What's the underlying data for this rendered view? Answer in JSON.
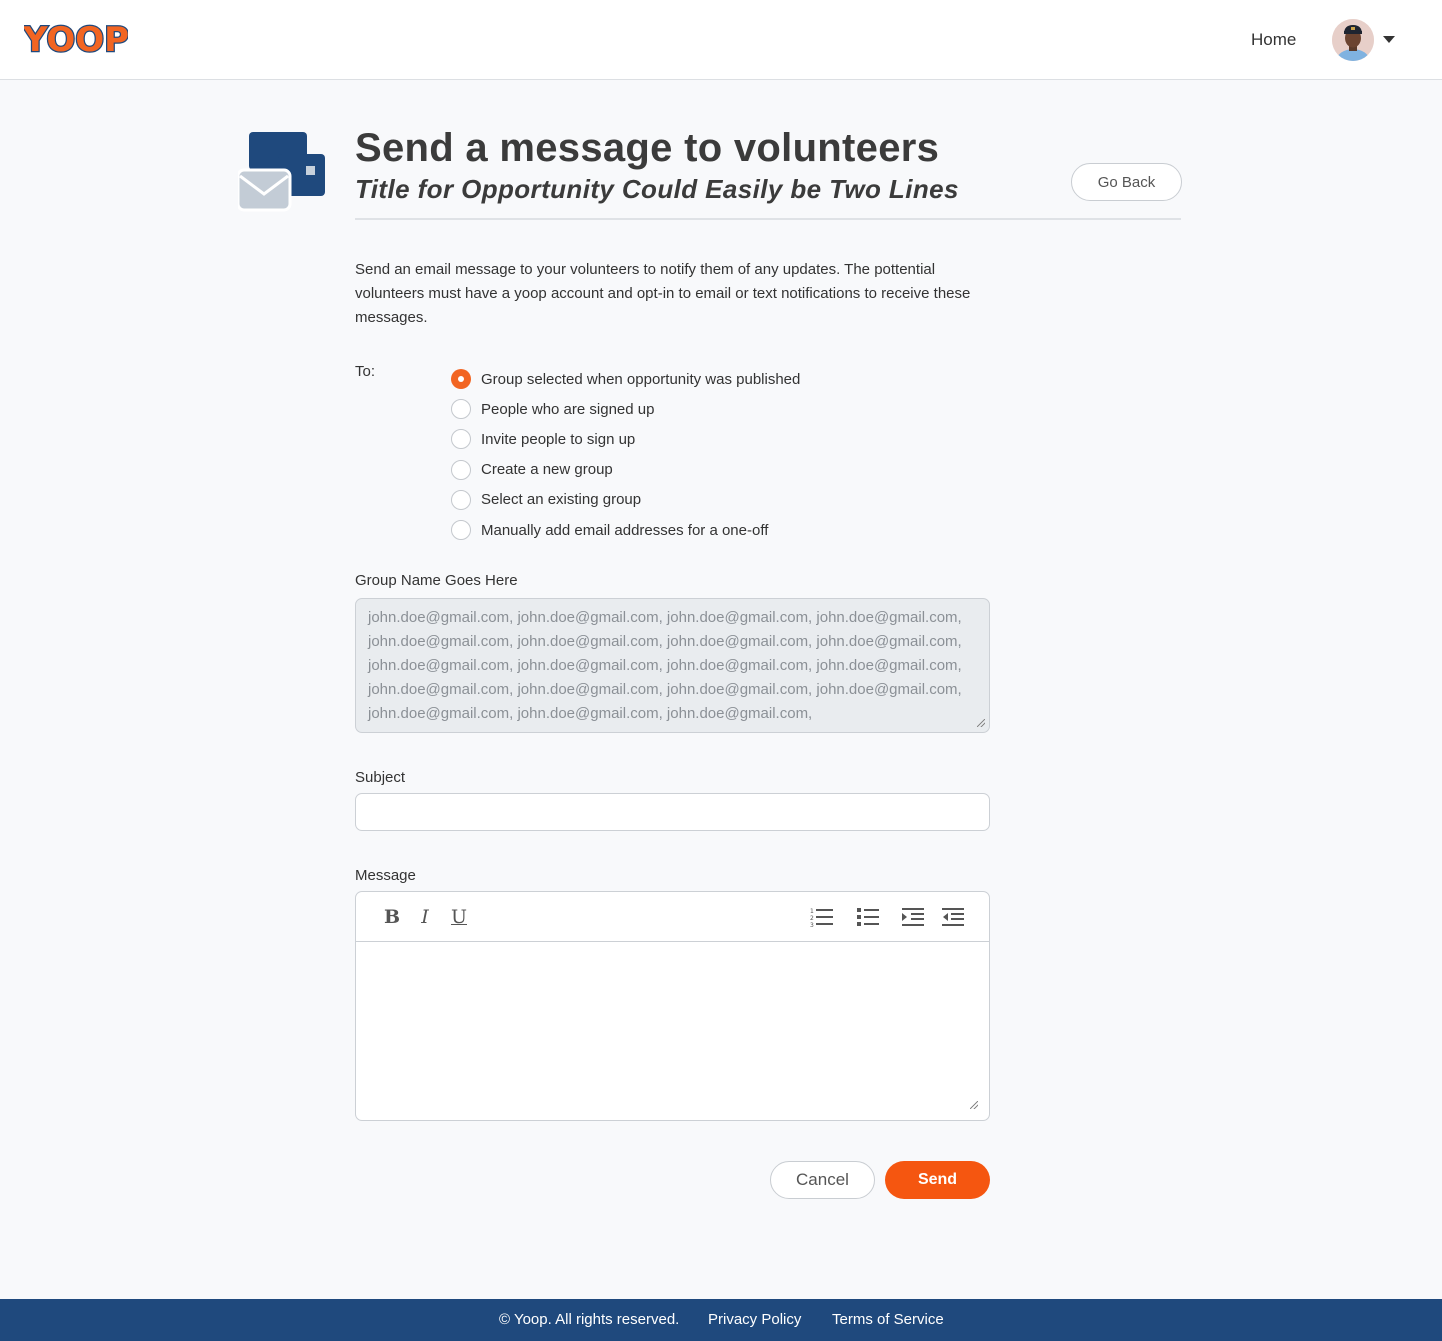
{
  "header": {
    "logo_text": "YOOP",
    "nav_home": "Home",
    "avatar_alt": "User avatar"
  },
  "page": {
    "title": "Send a message to volunteers",
    "subtitle": "Title for Opportunity Could Easily be Two Lines",
    "go_back": "Go Back",
    "intro": "Send an email message to your volunteers to notify them of any updates. The pottential volunteers must have a yoop account and opt-in to email or text notifications to receive these messages."
  },
  "recipients": {
    "label": "To:",
    "options": [
      {
        "label": "Group selected when opportunity was published",
        "checked": true
      },
      {
        "label": "People who are signed up",
        "checked": false
      },
      {
        "label": "Invite people to sign up",
        "checked": false
      },
      {
        "label": "Create a new group",
        "checked": false
      },
      {
        "label": "Select an existing group",
        "checked": false
      },
      {
        "label": "Manually add email addresses for a one-off",
        "checked": false
      }
    ]
  },
  "group": {
    "label": "Group Name Goes Here",
    "emails": "john.doe@gmail.com, john.doe@gmail.com, john.doe@gmail.com, john.doe@gmail.com,\njohn.doe@gmail.com, john.doe@gmail.com, john.doe@gmail.com, john.doe@gmail.com,\njohn.doe@gmail.com, john.doe@gmail.com, john.doe@gmail.com, john.doe@gmail.com,\njohn.doe@gmail.com, john.doe@gmail.com, john.doe@gmail.com, john.doe@gmail.com,\njohn.doe@gmail.com, john.doe@gmail.com, john.doe@gmail.com,"
  },
  "subject": {
    "label": "Subject",
    "value": ""
  },
  "message": {
    "label": "Message",
    "toolbar": {
      "bold": "B",
      "italic": "I",
      "underline": "U",
      "icons": [
        "ordered-list-icon",
        "bullet-list-icon",
        "indent-icon",
        "outdent-icon"
      ]
    }
  },
  "actions": {
    "cancel": "Cancel",
    "send": "Send"
  },
  "footer": {
    "copyright": "© Yoop. All rights reserved.",
    "privacy": "Privacy Policy",
    "terms": "Terms of Service"
  },
  "colors": {
    "brand_orange": "#f55610",
    "brand_navy": "#1f497d",
    "radio_checked": "#f26522"
  }
}
